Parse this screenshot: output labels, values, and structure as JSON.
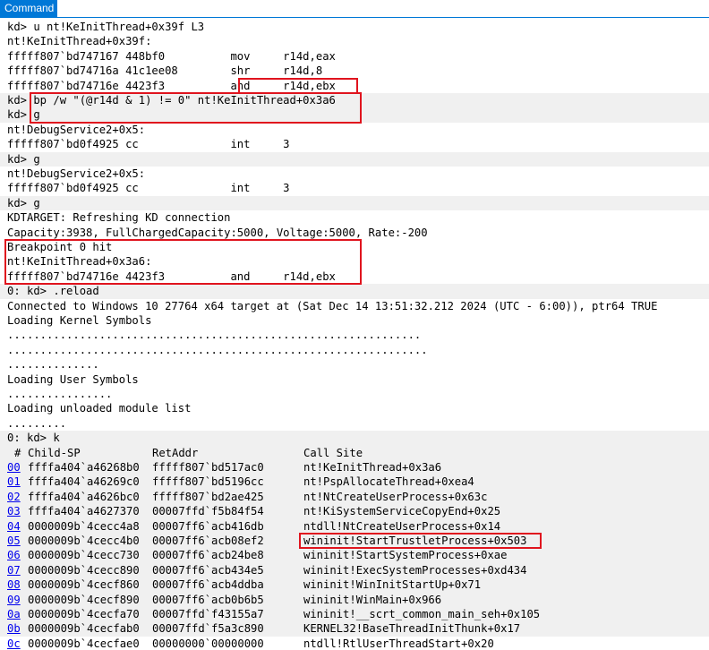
{
  "tab": {
    "label": "Command"
  },
  "top_lines": [
    "kd> u nt!KeInitThread+0x39f L3",
    "nt!KeInitThread+0x39f:",
    "fffff807`bd747167 448bf0          mov     r14d,eax",
    "fffff807`bd74716a 41c1ee08        shr     r14d,8",
    "fffff807`bd74716e 4423f3          and     r14d,ebx",
    "kd> bp /w \"(@r14d & 1) != 0\" nt!KeInitThread+0x3a6",
    "kd> g",
    "nt!DebugService2+0x5:",
    "fffff807`bd0f4925 cc              int     3",
    "kd> g",
    "nt!DebugService2+0x5:",
    "fffff807`bd0f4925 cc              int     3",
    "kd> g",
    "KDTARGET: Refreshing KD connection",
    "Capacity:3938, FullChargedCapacity:5000, Voltage:5000, Rate:-200",
    "Breakpoint 0 hit",
    "nt!KeInitThread+0x3a6:",
    "fffff807`bd74716e 4423f3          and     r14d,ebx",
    "0: kd> .reload",
    "Connected to Windows 10 27764 x64 target at (Sat Dec 14 13:51:32.212 2024 (UTC - 6:00)), ptr64 TRUE",
    "Loading Kernel Symbols",
    "...............................................................",
    "................................................................",
    "..............",
    "Loading User Symbols",
    "................",
    "Loading unloaded module list",
    ".........",
    "0: kd> k"
  ],
  "stack_header": {
    "num": "#",
    "child_sp": "Child-SP",
    "ret_addr": "RetAddr",
    "call_site": "Call Site"
  },
  "stack_frames": [
    {
      "num": "00",
      "child_sp": "ffffa404`a46268b0",
      "ret_addr": "fffff807`bd517ac0",
      "call_site": "nt!KeInitThread+0x3a6"
    },
    {
      "num": "01",
      "child_sp": "ffffa404`a46269c0",
      "ret_addr": "fffff807`bd5196cc",
      "call_site": "nt!PspAllocateThread+0xea4"
    },
    {
      "num": "02",
      "child_sp": "ffffa404`a4626bc0",
      "ret_addr": "fffff807`bd2ae425",
      "call_site": "nt!NtCreateUserProcess+0x63c"
    },
    {
      "num": "03",
      "child_sp": "ffffa404`a4627370",
      "ret_addr": "00007ffd`f5b84f54",
      "call_site": "nt!KiSystemServiceCopyEnd+0x25"
    },
    {
      "num": "04",
      "child_sp": "0000009b`4cecc4a8",
      "ret_addr": "00007ff6`acb416db",
      "call_site": "ntdll!NtCreateUserProcess+0x14"
    },
    {
      "num": "05",
      "child_sp": "0000009b`4cecc4b0",
      "ret_addr": "00007ff6`acb08ef2",
      "call_site": "wininit!StartTrustletProcess+0x503"
    },
    {
      "num": "06",
      "child_sp": "0000009b`4cecc730",
      "ret_addr": "00007ff6`acb24be8",
      "call_site": "wininit!StartSystemProcess+0xae"
    },
    {
      "num": "07",
      "child_sp": "0000009b`4cecc890",
      "ret_addr": "00007ff6`acb434e5",
      "call_site": "wininit!ExecSystemProcesses+0xd434"
    },
    {
      "num": "08",
      "child_sp": "0000009b`4cecf860",
      "ret_addr": "00007ff6`acb4ddba",
      "call_site": "wininit!WinInitStartUp+0x71"
    },
    {
      "num": "09",
      "child_sp": "0000009b`4cecf890",
      "ret_addr": "00007ff6`acb0b6b5",
      "call_site": "wininit!WinMain+0x966"
    },
    {
      "num": "0a",
      "child_sp": "0000009b`4cecfa70",
      "ret_addr": "00007ffd`f43155a7",
      "call_site": "wininit!__scrt_common_main_seh+0x105"
    },
    {
      "num": "0b",
      "child_sp": "0000009b`4cecfab0",
      "ret_addr": "00007ffd`f5a3c890",
      "call_site": "KERNEL32!BaseThreadInitThunk+0x17"
    },
    {
      "num": "0c",
      "child_sp": "0000009b`4cecfae0",
      "ret_addr": "00000000`00000000",
      "call_site": "ntdll!RtlUserThreadStart+0x20"
    }
  ],
  "colors": {
    "tab_bg": "#0078d7",
    "highlight_box": "#e0141e",
    "band": "#f0f0f0",
    "link": "#0000ee"
  }
}
